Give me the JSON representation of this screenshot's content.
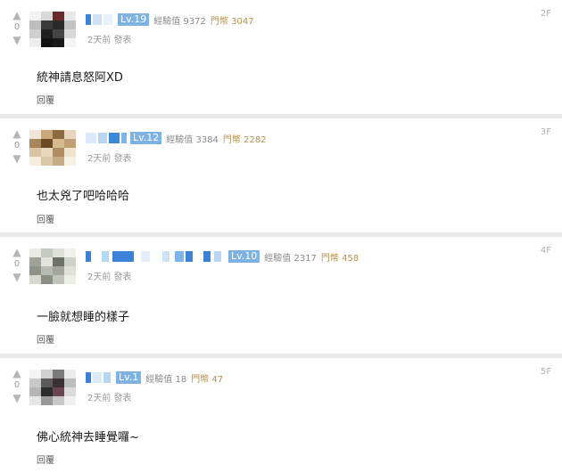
{
  "colors": {
    "level_badge": "#7eb2e3",
    "coin_text": "#b49253",
    "background": "#e9e9e9"
  },
  "icons": {
    "upvote": "arrow-up-icon",
    "downvote": "arrow-down-icon"
  },
  "comments": [
    {
      "floor": "2F",
      "level": "Lv.19",
      "exp": "經驗值 9372",
      "coins": "門幣 3047",
      "time": "2天前 發表",
      "votes": "0",
      "text": "統神請息怒阿XD",
      "reply": "回覆"
    },
    {
      "floor": "3F",
      "level": "Lv.12",
      "exp": "經驗值 3384",
      "coins": "門幣 2282",
      "time": "2天前 發表",
      "votes": "0",
      "text": "也太兇了吧哈哈哈",
      "reply": "回覆"
    },
    {
      "floor": "4F",
      "level": "Lv.10",
      "exp": "經驗值 2317",
      "coins": "門幣 458",
      "time": "2天前 發表",
      "votes": "0",
      "text": "一臉就想睡的樣子",
      "reply": "回覆"
    },
    {
      "floor": "5F",
      "level": "Lv.1",
      "exp": "經驗值 18",
      "coins": "門幣 47",
      "time": "2天前 發表",
      "votes": "0",
      "text": "佛心統神去睡覺囉~",
      "reply": "回覆"
    }
  ]
}
